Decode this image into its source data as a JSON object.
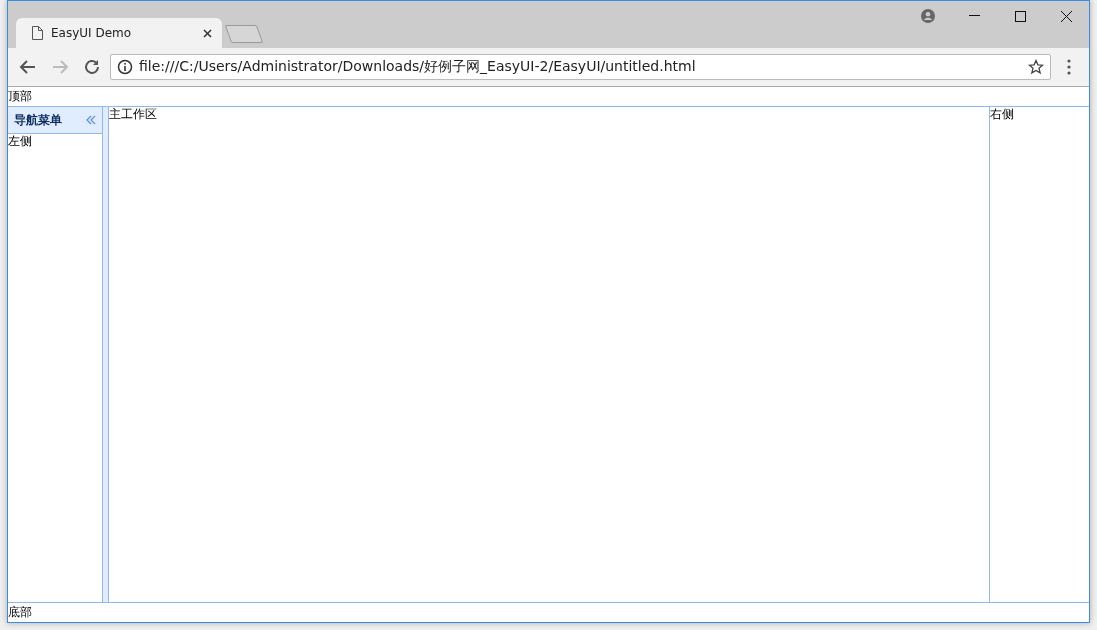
{
  "browser": {
    "tabs": [
      {
        "title": "EasyUI Demo",
        "selected": true
      }
    ],
    "address": "file:///C:/Users/Administrator/Downloads/好例子网_EasyUI-2/EasyUI/untitled.html"
  },
  "layout": {
    "north": "顶部",
    "west": {
      "title": "导航菜单",
      "content": "左侧"
    },
    "center": "主工作区",
    "east": "右侧",
    "south": "底部"
  }
}
